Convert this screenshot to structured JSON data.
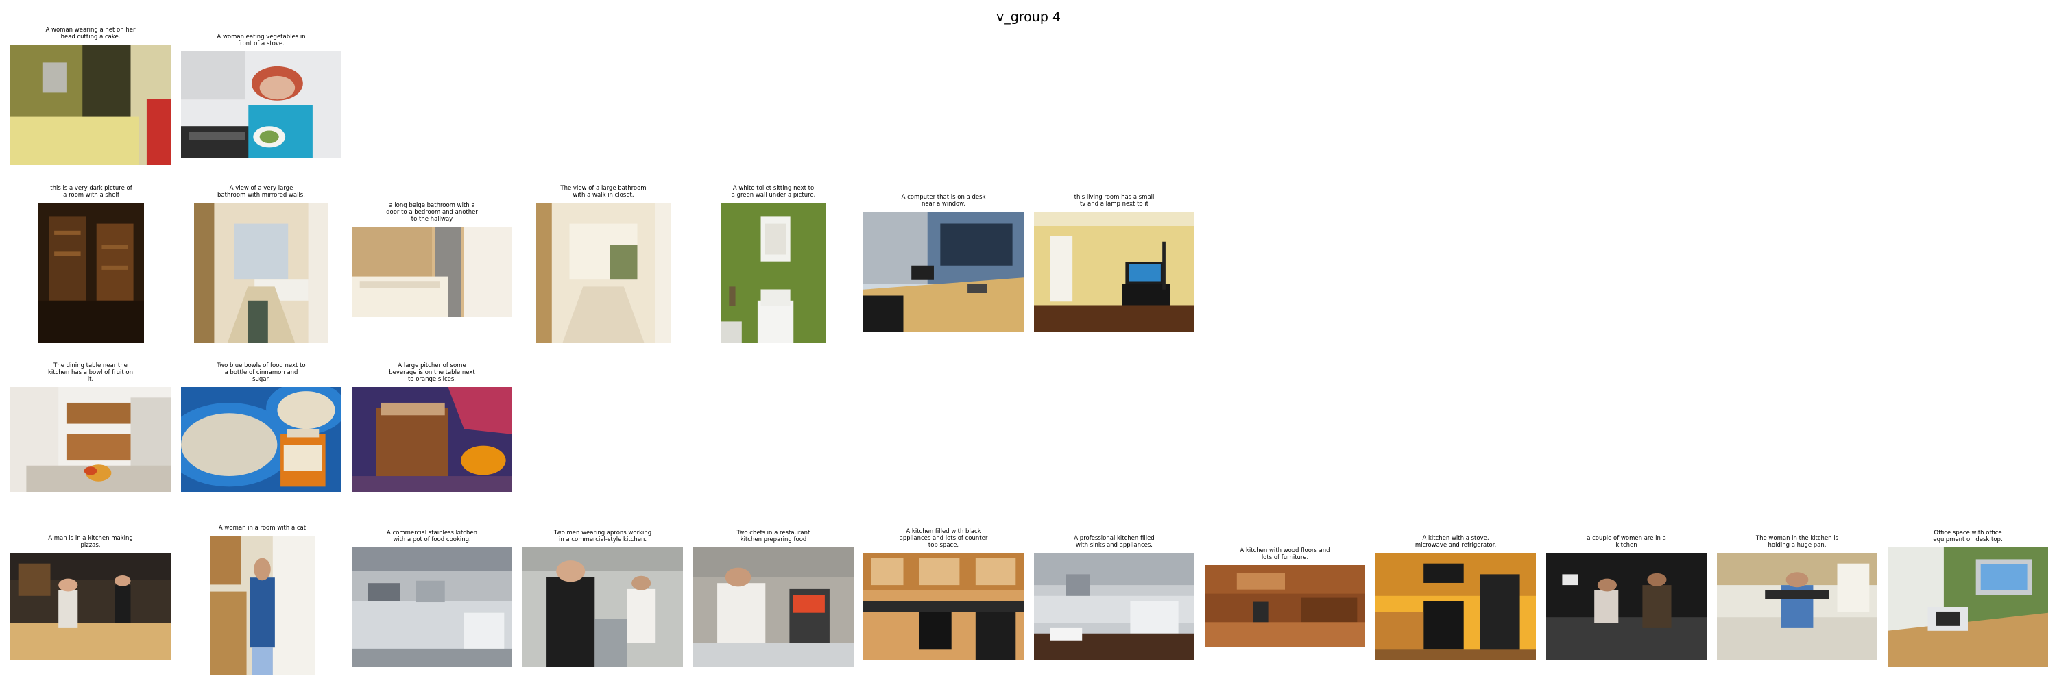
{
  "title": "v_group 4",
  "rows": [
    {
      "cells": [
        {
          "caption": "A woman wearing a net on her\nhead cutting a cake.",
          "scene": "yellow-room"
        },
        {
          "caption": "A woman eating vegetables in\nfront of a stove.",
          "scene": "woman-eating"
        }
      ]
    },
    {
      "cells": [
        {
          "caption": "this is a very dark picture of\na room with a shelf",
          "scene": "dark-room"
        },
        {
          "caption": "A view of a very large\nbathroom with mirrored walls.",
          "scene": "bathroom-hall"
        },
        {
          "caption": "a long beige bathroom with a\ndoor to a bedroom and another\nto the hallway",
          "scene": "beige-bathroom"
        },
        {
          "caption": "The view of a large bathroom\nwith a walk in closet.",
          "scene": "bathroom-closet"
        },
        {
          "caption": "A white toilet sitting next to\na green wall under a picture.",
          "scene": "green-toilet"
        },
        {
          "caption": "A computer that is on a desk\nnear a window.",
          "scene": "office-desk"
        },
        {
          "caption": "this living room has a small\ntv and a lamp next to it",
          "scene": "living-room"
        }
      ]
    },
    {
      "cells": [
        {
          "caption": "The dining table near the\nkitchen has a bowl of fruit on\nit.",
          "scene": "white-kitchen"
        },
        {
          "caption": "Two blue bowls of food next to\na bottle of cinnamon and\nsugar.",
          "scene": "blue-bowls"
        },
        {
          "caption": "A large pitcher of some\nbeverage is on the table next\nto orange slices.",
          "scene": "pitcher"
        }
      ]
    },
    {
      "cells": [
        {
          "caption": "A man is in a kitchen making\npizzas.",
          "scene": "pizza-kitchen"
        },
        {
          "caption": "A woman in a room with a cat",
          "scene": "woman-cat"
        },
        {
          "caption": "A commercial stainless kitchen\nwith a pot of food cooking.",
          "scene": "steel-kitchen"
        },
        {
          "caption": "Two men wearing aprons working\nin a commercial-style kitchen.",
          "scene": "men-aprons"
        },
        {
          "caption": "Two chefs in a restaurant\nkitchen preparing food",
          "scene": "chefs"
        },
        {
          "caption": "A kitchen filled with black\nappliances and lots of counter\ntop space.",
          "scene": "black-appliances"
        },
        {
          "caption": "A professional kitchen filled\nwith sinks and appliances.",
          "scene": "pro-kitchen"
        },
        {
          "caption": "A kitchen with wood floors and\nlots of furniture.",
          "scene": "wood-kitchen"
        },
        {
          "caption": "A kitchen with a stove,\nmicrowave and refrigerator.",
          "scene": "stove-kitchen"
        },
        {
          "caption": "a couple of women  are in a\nkitchen",
          "scene": "dark-kitchen-women"
        },
        {
          "caption": "The woman in the kitchen is\nholding a huge pan.",
          "scene": "woman-pan"
        },
        {
          "caption": "Office space with office\nequipment on desk top.",
          "scene": "office-space"
        }
      ]
    }
  ]
}
